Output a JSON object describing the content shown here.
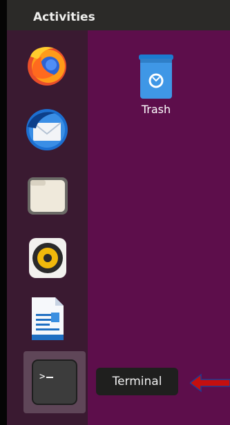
{
  "topbar": {
    "activities_label": "Activities"
  },
  "dock": {
    "items": [
      {
        "name": "Firefox",
        "icon": "firefox-icon"
      },
      {
        "name": "Thunderbird",
        "icon": "thunderbird-icon"
      },
      {
        "name": "Files",
        "icon": "files-icon"
      },
      {
        "name": "Rhythmbox",
        "icon": "rhythmbox-icon"
      },
      {
        "name": "LibreOffice Writer",
        "icon": "writer-icon"
      },
      {
        "name": "Terminal",
        "icon": "terminal-icon",
        "active": true
      }
    ]
  },
  "desktop": {
    "trash_label": "Trash"
  },
  "tooltip": {
    "text": "Terminal"
  },
  "colors": {
    "desktop": "#5d0e4b",
    "dock": "#3a1a31",
    "topbar": "#2b2a28",
    "arrow": "#c40f0f"
  }
}
